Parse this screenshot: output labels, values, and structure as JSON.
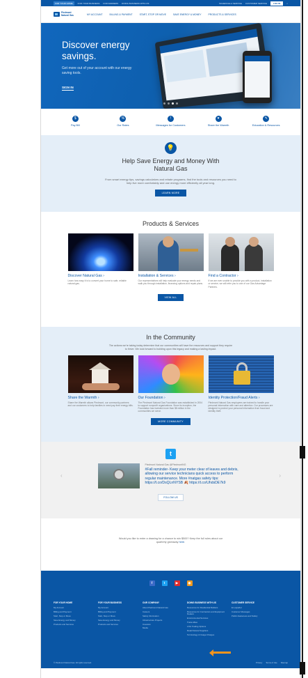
{
  "util_bar": {
    "links": [
      "FOR YOUR HOME",
      "FOR YOUR BUSINESS",
      "FOR FARMERS",
      "DOING BUSINESS WITH US"
    ],
    "right_links": [
      "SCHEDULE A SERVICE",
      "CUSTOMER SERVICE"
    ],
    "login": "LOG IN"
  },
  "nav": {
    "logo_lines": [
      "Piedmont",
      "Natural Gas"
    ],
    "items": [
      "MY ACCOUNT",
      "BILLING & PAYMENT",
      "START, STOP OR MOVE",
      "SAVE ENERGY & MONEY",
      "PRODUCTS & SERVICES"
    ]
  },
  "hero": {
    "title": "Discover energy savings.",
    "subtitle": "Get more out of your account with our energy saving tools.",
    "signin": "SIGN IN"
  },
  "quick_links": [
    {
      "icon": "$",
      "label": "Pay Bill"
    },
    {
      "icon": "%",
      "label": "Our Rates"
    },
    {
      "icon": "!",
      "label": "Messages for Customers"
    },
    {
      "icon": "♥",
      "label": "Share the Warmth"
    },
    {
      "icon": "✎",
      "label": "Education & Resources"
    }
  ],
  "save_section": {
    "title": "Help Save Energy and Money With Natural Gas",
    "body": "From smart energy tips, savings calculators and rebate programs, find the tools and resources you need to help live more comfortably and use energy more efficiently all year long.",
    "button": "LEARN MORE"
  },
  "products": {
    "title": "Products & Services",
    "cards": [
      {
        "title": "Discover Natural Gas ›",
        "body": "Learn how easy it is to convert your home to safe, reliable natural gas."
      },
      {
        "title": "Installation & Services ›",
        "body": "Our representatives will help evaluate your energy needs and walk you through installation, financing options and repair plans."
      },
      {
        "title": "Find a Contractor ›",
        "body": "If we are ever unable to provide you with a product, installation or service, we will refer you to one of our Gas Advantage Partners."
      }
    ],
    "button": "VIEW ALL"
  },
  "community": {
    "title": "In the Community",
    "intro": "The actions we're taking today determine that our communities will have the resources and support they require to thrive. We look forward to building upon this legacy and making a lasting impact.",
    "cards": [
      {
        "title": "Share the Warmth ›",
        "body": "Share the Warmth allows Piedmont, our community partners and our customers to help families in need pay their energy bills."
      },
      {
        "title": "Our Foundation ›",
        "body": "The Piedmont Natural Gas Foundation was established in 2004 to support nonprofit organizations. Since its inception, the Foundation has invested more than $8 million in the communities we serve."
      },
      {
        "title": "Identity Protection/Fraud Alerts ›",
        "body": "Piedmont Natural Gas employees are trained to handle your personal information with care and attention. Our processes are designed to protect your personal information from fraud and identity theft."
      }
    ],
    "button": "MORE COMMUNITY"
  },
  "social": {
    "handle": "Piedmont Natural Gas @PiedmontNG",
    "tweet": "#Fall reminder- Keep your meter clear of leaves and debris, allowing our service technicians quick access to perform regular maintenance. More #natgas safety tips: https://t.co/DsQLnNYSB 🍂 https://t.co/UhdsDE7k9",
    "follow": "FOLLOW US",
    "prev": "‹",
    "next": "›"
  },
  "sweepstakes": {
    "text": "Would you like to enter a drawing for a chance to win $500? Keep the full rules about our quarterly giveaway",
    "link": "here"
  },
  "footer": {
    "social_icons": [
      "f",
      "t",
      "▶",
      "◉"
    ],
    "columns": [
      {
        "heading": "FOR YOUR HOME",
        "links": [
          "My Account",
          "Billing and Payment",
          "Start, Stop or Move",
          "Save Energy and Money",
          "Products and Services"
        ]
      },
      {
        "heading": "FOR YOUR BUSINESS",
        "links": [
          "My Account",
          "Billing and Payment",
          "Start, Stop or Move",
          "Save Energy and Money",
          "Products and Services"
        ]
      },
      {
        "heading": "OUR COMPANY",
        "links": [
          "About Piedmont Natural Gas",
          "Careers",
          "Safety Information",
          "Infrastructure Projects",
          "Investors",
          "Media"
        ]
      },
      {
        "heading": "DOING BUSINESS WITH US",
        "links": [
          "Resources for Residential Builders",
          "Resources for Contractors and Equipment Dealers",
          "Environmental Services",
          "Trade Allies",
          "LNG Trading Options",
          "Retail Natural Suppliers",
          "Terminology & Usage Charges"
        ]
      },
      {
        "heading": "CUSTOMER SERVICE",
        "links": [
          "En español",
          "Customer Messages",
          "Public Awareness and Safety"
        ]
      }
    ],
    "copyright": "© Piedmont Natural Gas. All rights reserved.",
    "bottom_links": [
      "Privacy",
      "Terms of Use",
      "Sitemap"
    ]
  }
}
